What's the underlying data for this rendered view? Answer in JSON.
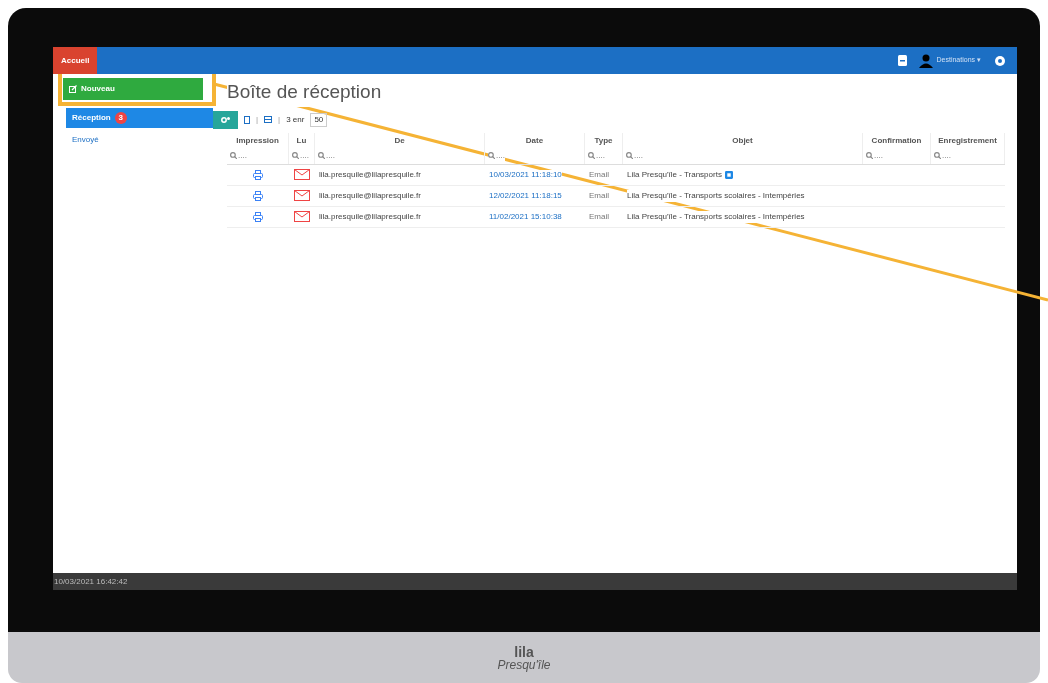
{
  "topbar": {
    "home_tab": "Accueil",
    "user": "Destinations ▾"
  },
  "sidebar": {
    "new_button": "Nouveau",
    "items": [
      {
        "label": "Réception",
        "badge": "3",
        "selected": true
      },
      {
        "label": "Envoyé",
        "selected": false
      }
    ]
  },
  "page_title": "Boîte de réception",
  "toolbar": {
    "separator": "|",
    "count": "3 enr",
    "page_size": "50"
  },
  "table": {
    "columns": [
      {
        "label": "Impression"
      },
      {
        "label": "Lu"
      },
      {
        "label": "De"
      },
      {
        "label": "Date"
      },
      {
        "label": "Type"
      },
      {
        "label": "Objet"
      },
      {
        "label": "Confirmation"
      },
      {
        "label": "Enregistrement"
      }
    ],
    "filter_placeholder": "....",
    "rows": [
      {
        "from": "lila.presquile@lilapresquile.fr",
        "date": "10/03/2021 11:18:10",
        "type": "Email",
        "subject": "Lila Presqu'île - Transports",
        "read": false,
        "attachment": true
      },
      {
        "from": "lila.presquile@lilapresquile.fr",
        "date": "12/02/2021 11:18:15",
        "type": "Email",
        "subject": "Lila Presqu'île - Transports scolaires - Intempéries",
        "read": false,
        "attachment": false
      },
      {
        "from": "lila.presquile@lilapresquile.fr",
        "date": "11/02/2021 15:10:38",
        "type": "Email",
        "subject": "Lila Presqu'île - Transports scolaires - Intempéries",
        "read": false,
        "attachment": false
      }
    ]
  },
  "status_bar": "10/03/2021 16:42:42",
  "brand": {
    "line1": "lila",
    "line2": "Presqu'île"
  }
}
